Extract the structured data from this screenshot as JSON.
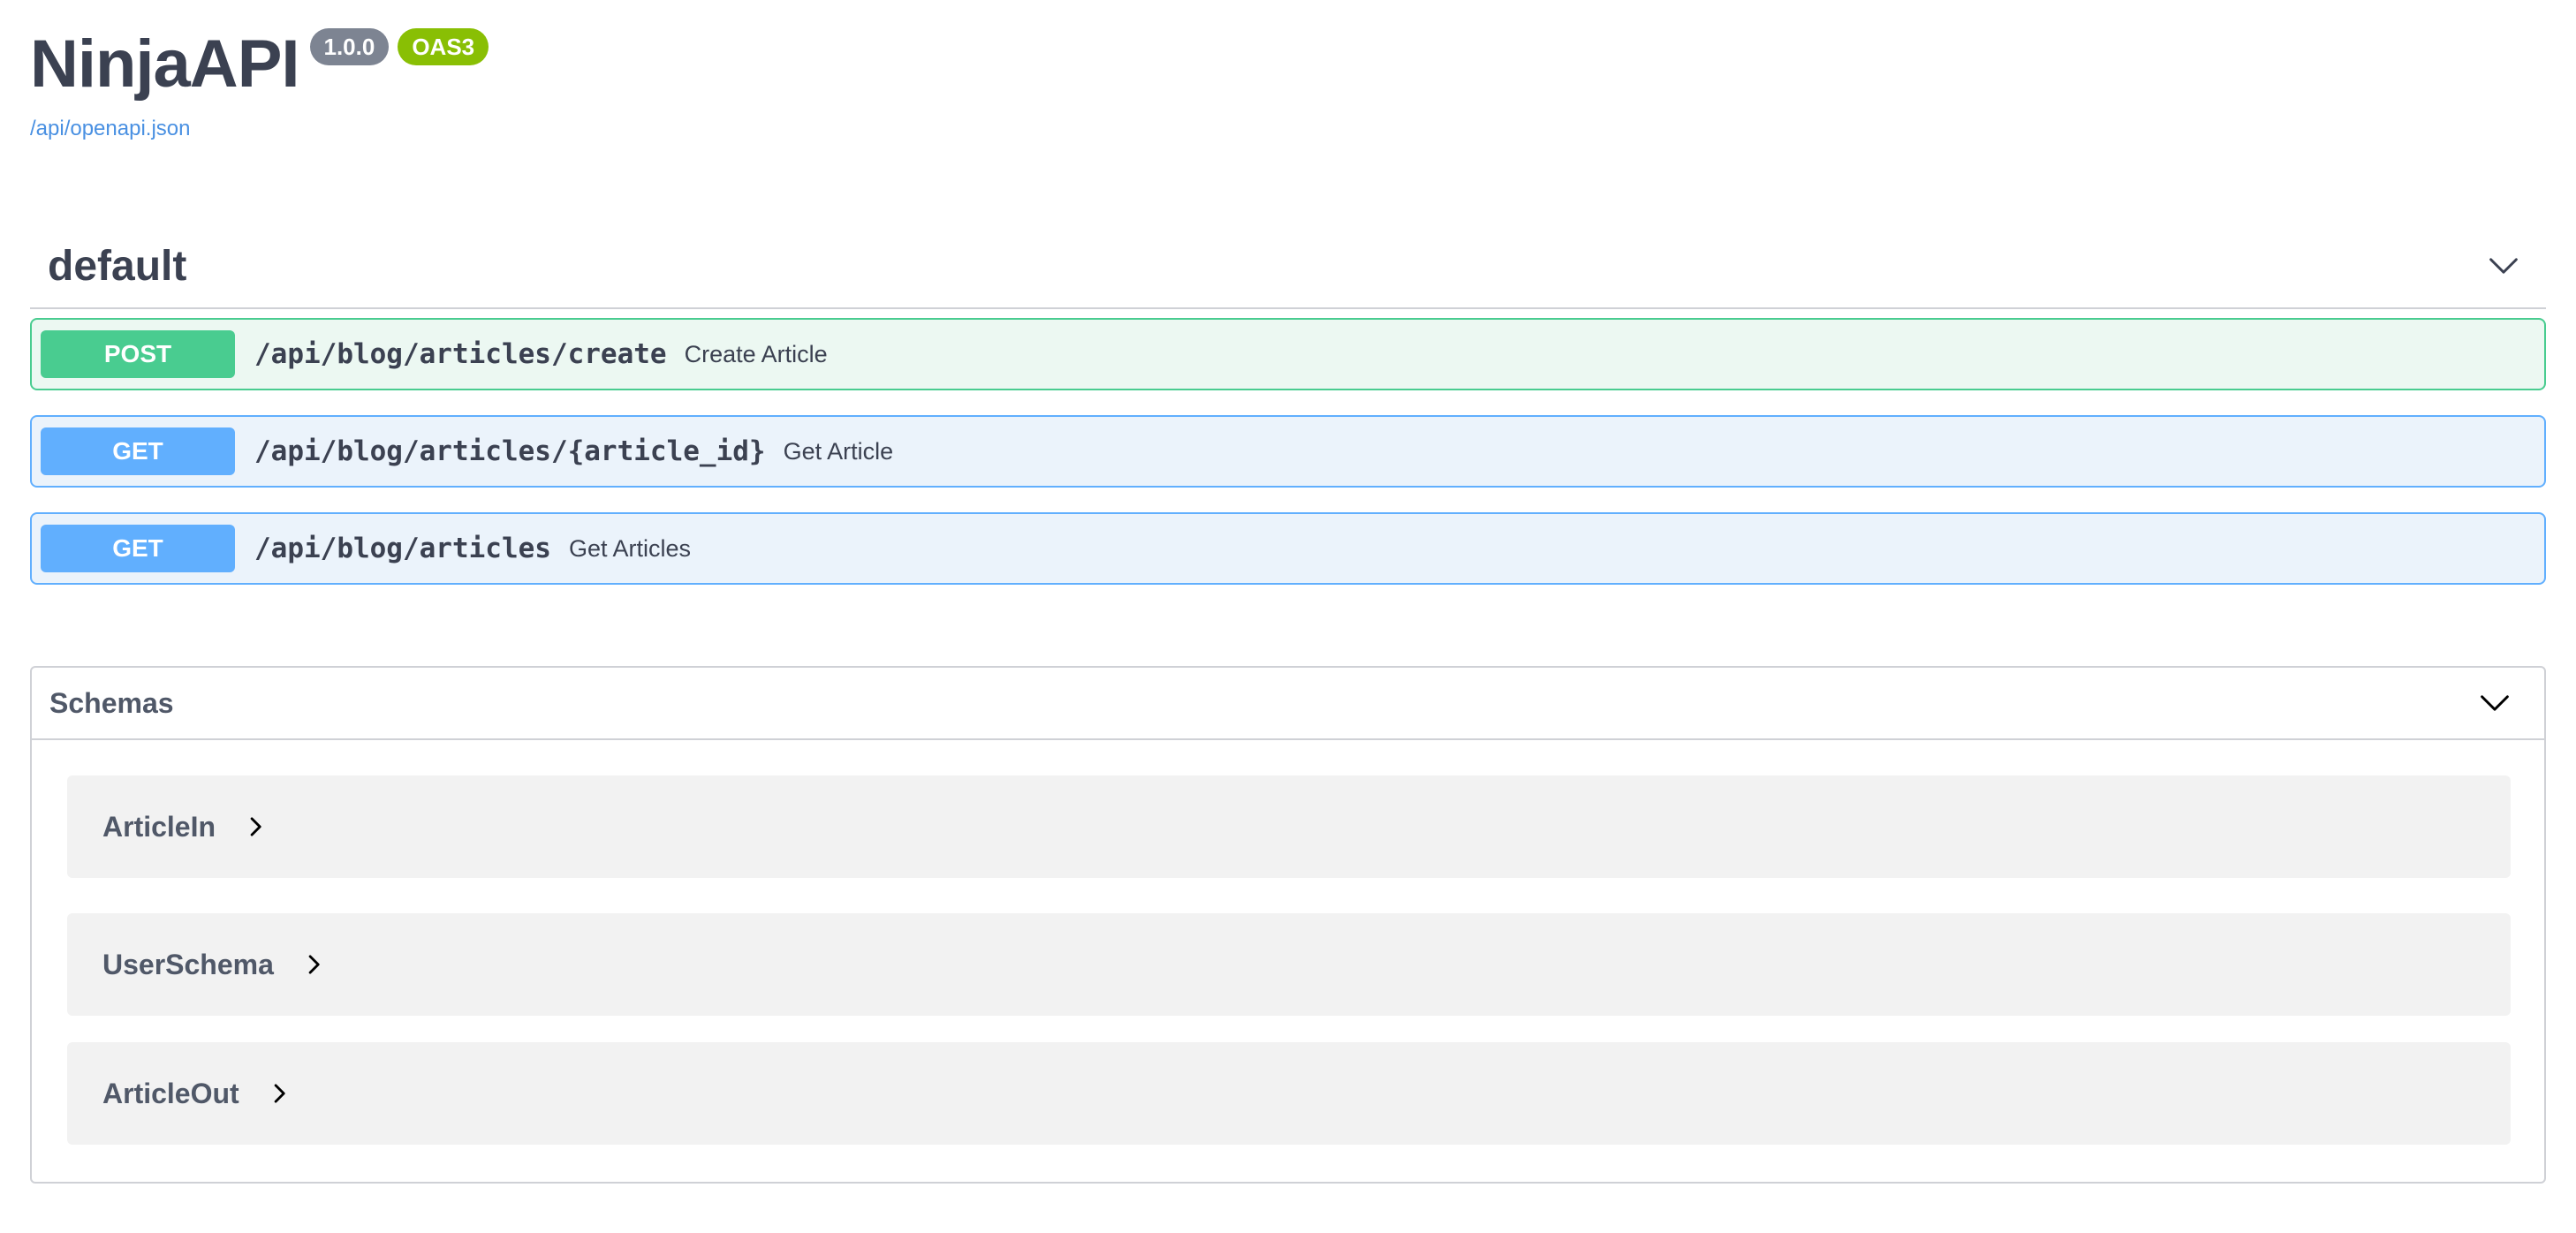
{
  "info": {
    "title": "NinjaAPI",
    "version": "1.0.0",
    "oas": "OAS3",
    "spec_link": "/api/openapi.json"
  },
  "tag": {
    "name": "default",
    "operations": [
      {
        "method": "POST",
        "path": "/api/blog/articles/create",
        "summary": "Create Article"
      },
      {
        "method": "GET",
        "path": "/api/blog/articles/{article_id}",
        "summary": "Get Article"
      },
      {
        "method": "GET",
        "path": "/api/blog/articles",
        "summary": "Get Articles"
      }
    ]
  },
  "schemas": {
    "title": "Schemas",
    "models": [
      "ArticleIn",
      "UserSchema",
      "ArticleOut"
    ]
  },
  "colors": {
    "post": "#49cc90",
    "get": "#61affe",
    "version_badge": "#7d8492",
    "oas_badge": "#89bf04",
    "link": "#4990e2"
  },
  "icons": {
    "section_toggle": "chevron-down-icon",
    "model_toggle": "chevron-right-icon"
  }
}
